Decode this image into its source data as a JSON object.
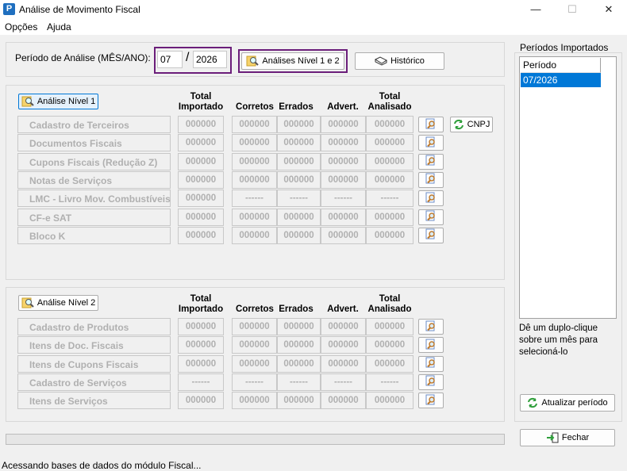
{
  "window": {
    "title": "Análise de Movimento Fiscal",
    "app_icon": "P",
    "minimize": "—",
    "maximize": "☐",
    "close": "✕"
  },
  "menu": {
    "options": "Opções",
    "help": "Ajuda"
  },
  "period": {
    "label": "Período de Análise (MÊS/ANO):",
    "month": "07",
    "separator": "/",
    "year": "2026"
  },
  "toolbar": {
    "analyses_button": "Análises Nível 1 e 2",
    "history_button": "Histórico"
  },
  "columns": {
    "total_imported": "Total\nImportado",
    "correct": "Corretos",
    "errors": "Errados",
    "warnings": "Advert.",
    "total_analyzed": "Total\nAnalisado"
  },
  "level1": {
    "button": "Análise Nível 1",
    "cnpj_button": "CNPJ",
    "rows": [
      {
        "label": "Cadastro de Terceiros",
        "total": "000000",
        "correct": "000000",
        "errors": "000000",
        "warnings": "000000",
        "analyzed": "000000"
      },
      {
        "label": "Documentos Fiscais",
        "total": "000000",
        "correct": "000000",
        "errors": "000000",
        "warnings": "000000",
        "analyzed": "000000"
      },
      {
        "label": "Cupons Fiscais (Redução Z)",
        "total": "000000",
        "correct": "000000",
        "errors": "000000",
        "warnings": "000000",
        "analyzed": "000000"
      },
      {
        "label": "Notas de Serviços",
        "total": "000000",
        "correct": "000000",
        "errors": "000000",
        "warnings": "000000",
        "analyzed": "000000"
      },
      {
        "label": "LMC - Livro Mov. Combustíveis",
        "total": "000000",
        "correct": "------",
        "errors": "------",
        "warnings": "------",
        "analyzed": "------"
      },
      {
        "label": "CF-e SAT",
        "total": "000000",
        "correct": "000000",
        "errors": "000000",
        "warnings": "000000",
        "analyzed": "000000"
      },
      {
        "label": "Bloco K",
        "total": "000000",
        "correct": "000000",
        "errors": "000000",
        "warnings": "000000",
        "analyzed": "000000"
      }
    ]
  },
  "level2": {
    "button": "Análise Nível 2",
    "rows": [
      {
        "label": "Cadastro de Produtos",
        "total": "000000",
        "correct": "000000",
        "errors": "000000",
        "warnings": "000000",
        "analyzed": "000000"
      },
      {
        "label": "Itens de Doc. Fiscais",
        "total": "000000",
        "correct": "000000",
        "errors": "000000",
        "warnings": "000000",
        "analyzed": "000000"
      },
      {
        "label": "Itens de Cupons Fiscais",
        "total": "000000",
        "correct": "000000",
        "errors": "000000",
        "warnings": "000000",
        "analyzed": "000000"
      },
      {
        "label": "Cadastro de Serviços",
        "total": "------",
        "correct": "------",
        "errors": "------",
        "warnings": "------",
        "analyzed": "------"
      },
      {
        "label": "Itens de Serviços",
        "total": "000000",
        "correct": "000000",
        "errors": "000000",
        "warnings": "000000",
        "analyzed": "000000"
      }
    ]
  },
  "imported_periods": {
    "title": "Períodos Importados",
    "column": "Período",
    "items": [
      "07/2026"
    ],
    "hint": "Dê um duplo-clique sobre um mês para selecioná-lo",
    "refresh_button": "Atualizar período"
  },
  "close_button": "Fechar",
  "status_text": "Acessando bases de dados do módulo Fiscal..."
}
